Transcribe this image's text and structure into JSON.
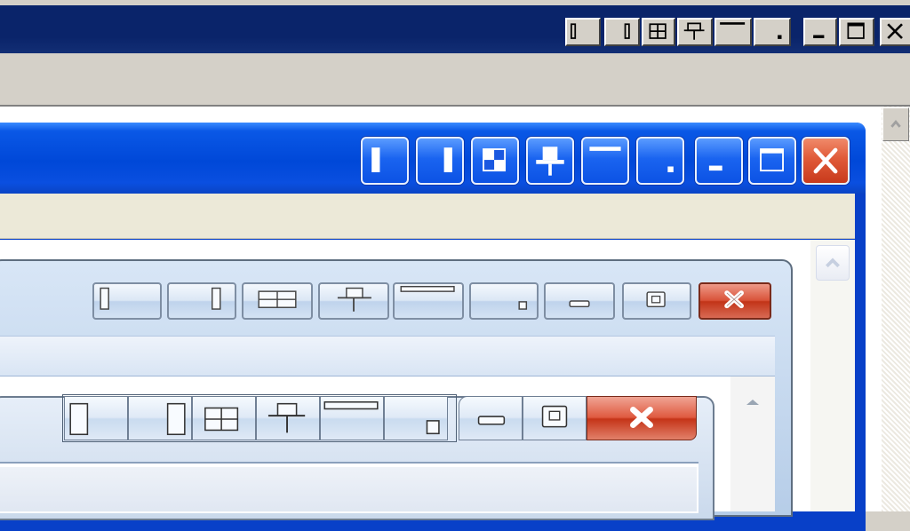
{
  "windows": [
    {
      "id": "classic",
      "theme": "Windows Classic",
      "caption_buttons": [
        "tile-left-icon",
        "tile-right-icon",
        "tile-grid-icon",
        "pin-icon",
        "dock-top-icon",
        "restore-corner-icon",
        "minimize-icon",
        "maximize-icon",
        "close-icon"
      ],
      "colors": {
        "titlebar": "#0a246a",
        "face": "#d4d0c8"
      }
    },
    {
      "id": "luna",
      "theme": "Windows XP Luna",
      "caption_buttons": [
        "tile-left-icon",
        "tile-right-icon",
        "tile-grid-icon",
        "pin-icon",
        "dock-top-icon",
        "restore-corner-icon",
        "minimize-icon",
        "maximize-icon",
        "close-icon"
      ],
      "colors": {
        "titlebar": "#0048d8",
        "close": "#d9481f"
      }
    },
    {
      "id": "vista",
      "theme": "Windows Vista Basic",
      "caption_buttons": [
        "tile-left-icon",
        "tile-right-icon",
        "tile-grid-icon",
        "pin-icon",
        "dock-top-icon",
        "restore-corner-icon",
        "minimize-icon",
        "maximize-icon",
        "close-icon"
      ],
      "colors": {
        "titlebar": "#c5d7ee",
        "close": "#c9381c"
      }
    },
    {
      "id": "aero",
      "theme": "Windows 7 Basic",
      "caption_buttons": [
        "tile-left-icon",
        "tile-right-icon",
        "tile-grid-icon",
        "pin-icon",
        "dock-top-icon",
        "restore-corner-icon",
        "minimize-icon",
        "maximize-icon",
        "close-icon"
      ],
      "colors": {
        "titlebar": "#d3e0f0",
        "close": "#c9381c"
      }
    }
  ]
}
